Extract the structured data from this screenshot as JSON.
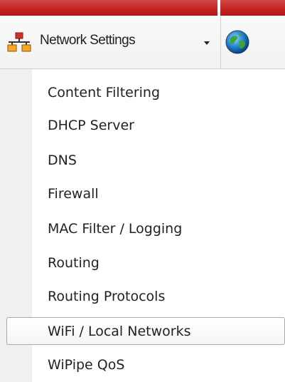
{
  "topbar": {
    "color": "#c42222"
  },
  "toolbar": {
    "network_settings_label": "Network Settings",
    "network_icon": "network-topology-icon",
    "dropdown_icon": "caret-down-icon",
    "globe_icon": "globe-icon"
  },
  "menu": {
    "items": [
      {
        "label": "Content Filtering",
        "active": false
      },
      {
        "label": "DHCP Server",
        "active": false
      },
      {
        "label": "DNS",
        "active": false
      },
      {
        "label": "Firewall",
        "active": false
      },
      {
        "label": "MAC Filter / Logging",
        "active": false
      },
      {
        "label": "Routing",
        "active": false
      },
      {
        "label": "Routing Protocols",
        "active": false
      },
      {
        "label": "WiFi / Local Networks",
        "active": true
      },
      {
        "label": "WiPipe QoS",
        "active": false
      }
    ]
  }
}
